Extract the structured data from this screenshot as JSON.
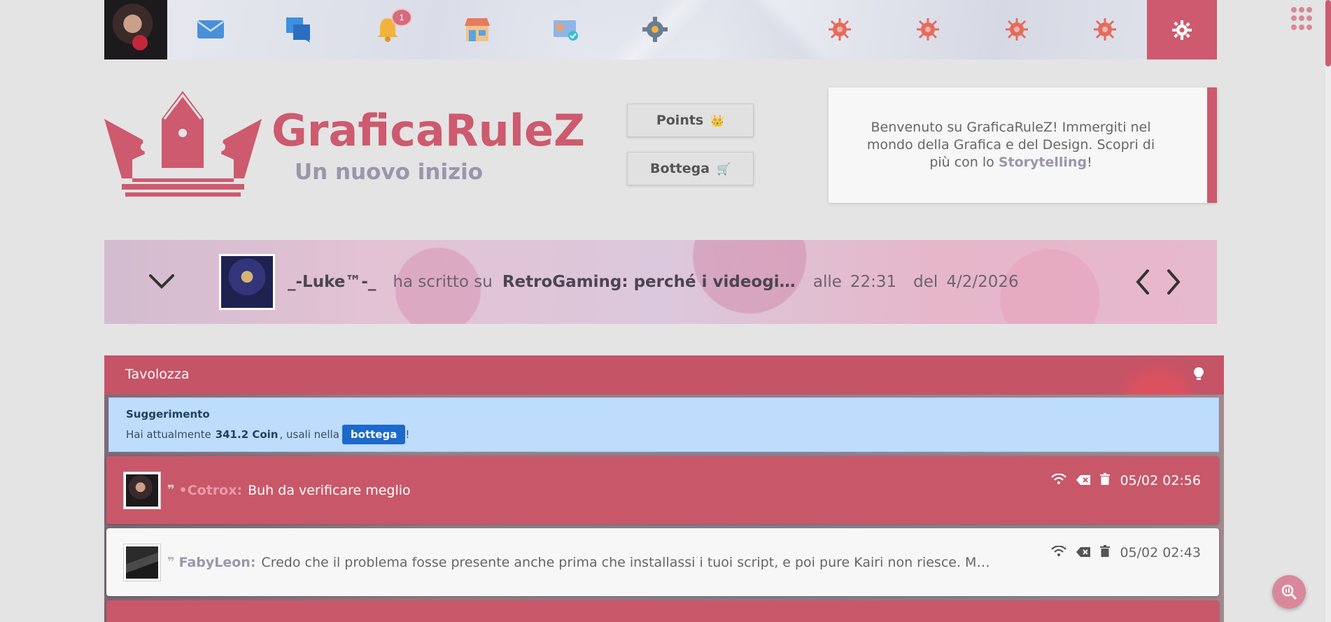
{
  "topbar": {
    "icons": [
      "avatar",
      "mail-icon",
      "chat-icon",
      "bell-icon",
      "shop-icon",
      "id-card-icon",
      "settings-gear-icon",
      "virus-icon",
      "virus-icon",
      "virus-icon",
      "virus-icon",
      "gear-icon"
    ],
    "notification_count": "1"
  },
  "header": {
    "title": "GraficaRuleZ",
    "subtitle": "Un nuovo inizio",
    "points_label": "Points",
    "points_icon": "👑",
    "bottega_label": "Bottega",
    "bottega_icon": "🛒",
    "welcome_pre": "Benvenuto su GraficaRuleZ! Immergiti nel mondo della Grafica e del Design. Scopri di più con lo ",
    "welcome_link": "Storytelling",
    "welcome_post": "!"
  },
  "last_post": {
    "user": "_-Luke™-_",
    "wrote_on": "ha scritto su",
    "thread": "RetroGaming: perché i videogiochi di una volta…",
    "at_label": "alle",
    "time": "22:31",
    "of_label": "del",
    "date": "4/2/2026"
  },
  "tavolozza": {
    "title": "Tavolozza",
    "suggestion": {
      "title": "Suggerimento",
      "pre": "Hai attualmente",
      "coins": "341.2 Coin",
      "mid": ", usali nella",
      "button": "bottega",
      "post": "!"
    },
    "messages": [
      {
        "user": "•Cotrox:",
        "text": "Buh da verificare meglio",
        "timestamp": "05/02 02:56",
        "style": "red"
      },
      {
        "user": "FabyLeon:",
        "text": "Credo che il problema fosse presente anche prima che installassi i tuoi script, e poi pure Kairi non riesce. Mah…",
        "timestamp": "05/02 02:43",
        "style": "white"
      }
    ]
  },
  "colors": {
    "accent": "#cd5a6e",
    "muted_purple": "#9b95ad",
    "info_bg": "#bedcfc",
    "button_blue": "#1d69c9"
  }
}
